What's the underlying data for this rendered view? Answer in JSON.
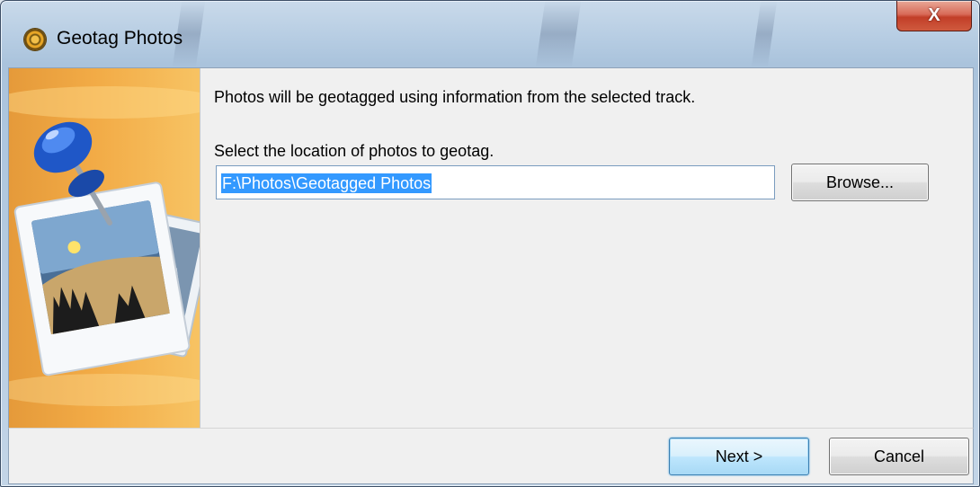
{
  "window": {
    "title": "Geotag Photos",
    "close_label": "X"
  },
  "main": {
    "intro_text": "Photos will be geotagged using information from the selected track.",
    "select_label": "Select the location of photos to geotag.",
    "path_value": "F:\\Photos\\Geotagged Photos",
    "browse_label": "Browse..."
  },
  "footer": {
    "next_label": "Next >",
    "cancel_label": "Cancel"
  },
  "icons": {
    "app": "compass-icon",
    "banner": "pushpin-photos-illustration"
  },
  "colors": {
    "selection": "#3399ff",
    "banner_orange": "#f2ab46",
    "close_red": "#c23e28"
  }
}
